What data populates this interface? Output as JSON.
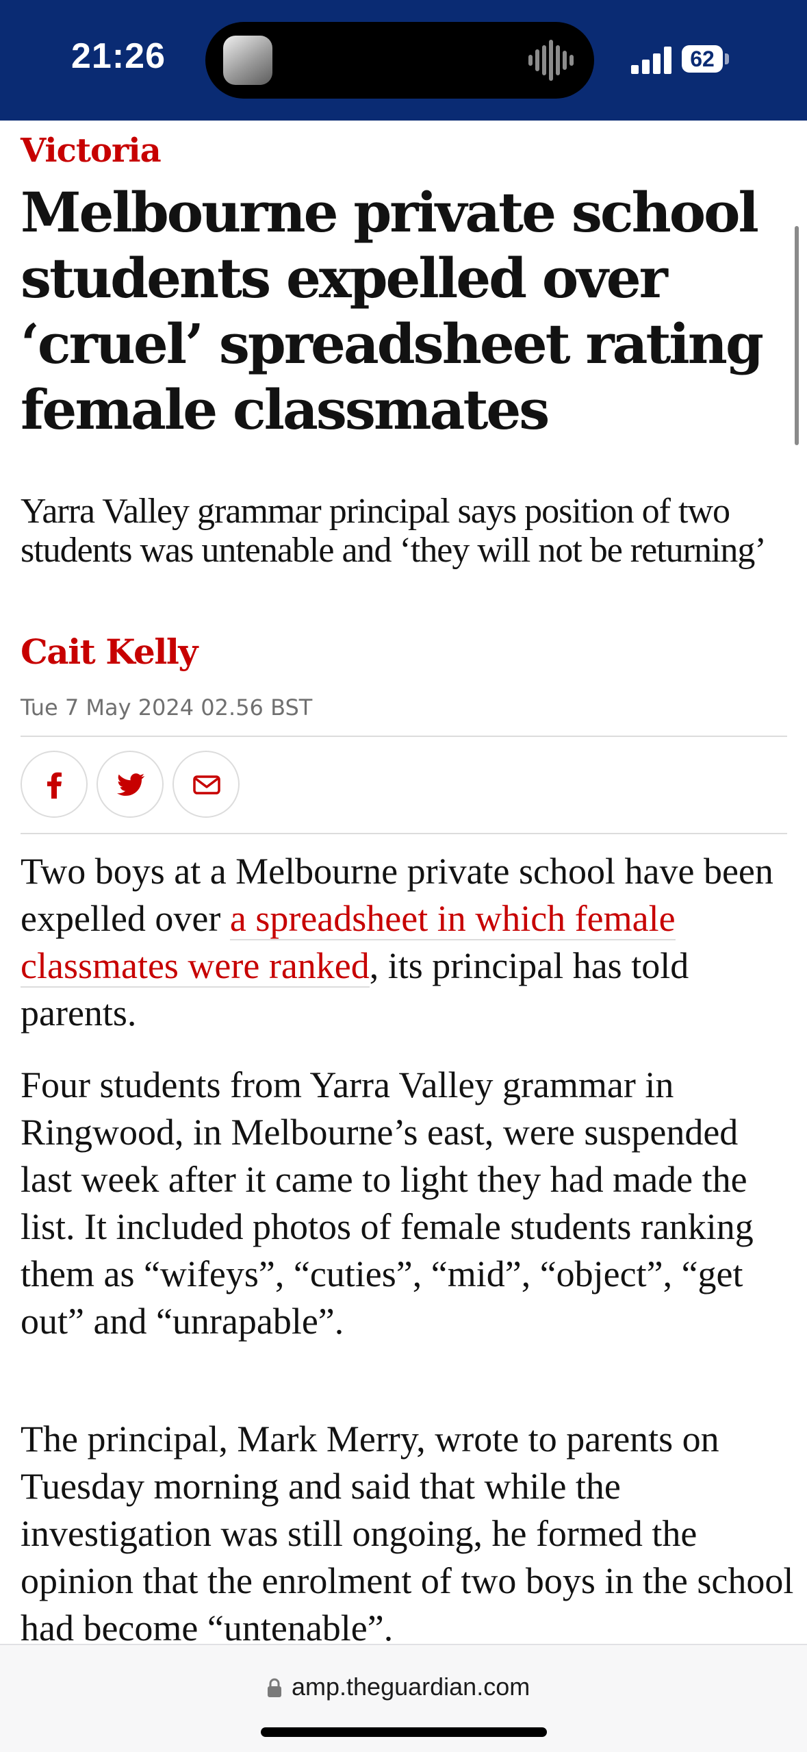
{
  "status_bar": {
    "time": "21:26",
    "battery": "62",
    "background_color": "#0a2b73"
  },
  "article": {
    "section": "Victoria",
    "headline": "Melbourne private school students expelled over ‘cruel’ spreadsheet rating female classmates",
    "standfirst": "Yarra Valley grammar principal says position of two students was untenable and ‘they will not be returning’",
    "byline": "Cait Kelly",
    "dateline": "Tue 7 May 2024 02.56 BST",
    "share": {
      "facebook_icon": "facebook-icon",
      "twitter_icon": "twitter-icon",
      "email_icon": "email-icon"
    },
    "paragraphs": {
      "p1_before": "Two boys at a Melbourne private school have been expelled over ",
      "p1_link": "a spreadsheet in which female classmates were ranked",
      "p1_after": ", its principal has told parents.",
      "p2": "Four students from Yarra Valley grammar in Ringwood, in Melbourne’s east, were suspended last week after it came to light they had made the list. It included photos of female students ranking them as “wifeys”, “cuties”, “mid”, “object”, “get out” and “unrapable”.",
      "p3": "The principal, Mark Merry, wrote to parents on Tuesday morning and said that while the investigation was still ongoing, he formed the opinion that the enrolment of two boys in the school had become “untenable”."
    },
    "accent_color": "#c70000"
  },
  "browser": {
    "url": "amp.theguardian.com"
  }
}
